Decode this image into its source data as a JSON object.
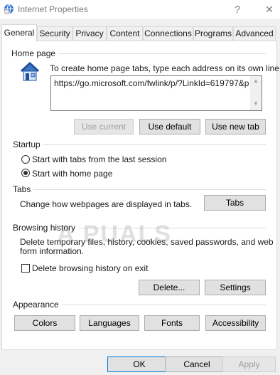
{
  "window": {
    "title": "Internet Properties",
    "help_label": "?",
    "close_label": "✕"
  },
  "tabs": [
    {
      "label": "General"
    },
    {
      "label": "Security"
    },
    {
      "label": "Privacy"
    },
    {
      "label": "Content"
    },
    {
      "label": "Connections"
    },
    {
      "label": "Programs"
    },
    {
      "label": "Advanced"
    }
  ],
  "home_page": {
    "title": "Home page",
    "description": "To create home page tabs, type each address on its own line.",
    "url_value": "https://go.microsoft.com/fwlink/p/?LinkId=619797&p",
    "use_current_label": "Use current",
    "use_default_label": "Use default",
    "use_new_tab_label": "Use new tab"
  },
  "startup": {
    "title": "Startup",
    "option1_label": "Start with tabs from the last session",
    "option2_label": "Start with home page",
    "selected": "Start with home page"
  },
  "tabs_section": {
    "title": "Tabs",
    "description": "Change how webpages are displayed in tabs.",
    "button_label": "Tabs"
  },
  "browsing_history": {
    "title": "Browsing history",
    "description_line1": "Delete temporary files, history, cookies, saved passwords, and web",
    "description_line2": "form information.",
    "checkbox_label": "Delete browsing history on exit",
    "checkbox_checked": false,
    "delete_label": "Delete...",
    "settings_label": "Settings"
  },
  "appearance": {
    "title": "Appearance",
    "colors_label": "Colors",
    "languages_label": "Languages",
    "fonts_label": "Fonts",
    "accessibility_label": "Accessibility"
  },
  "footer": {
    "ok_label": "OK",
    "cancel_label": "Cancel",
    "apply_label": "Apply"
  },
  "watermark": "A PUALS",
  "colors": {
    "window_bg": "#f0f0f0",
    "focus_border": "#0078d7",
    "disabled_text": "#9d9d9d"
  }
}
